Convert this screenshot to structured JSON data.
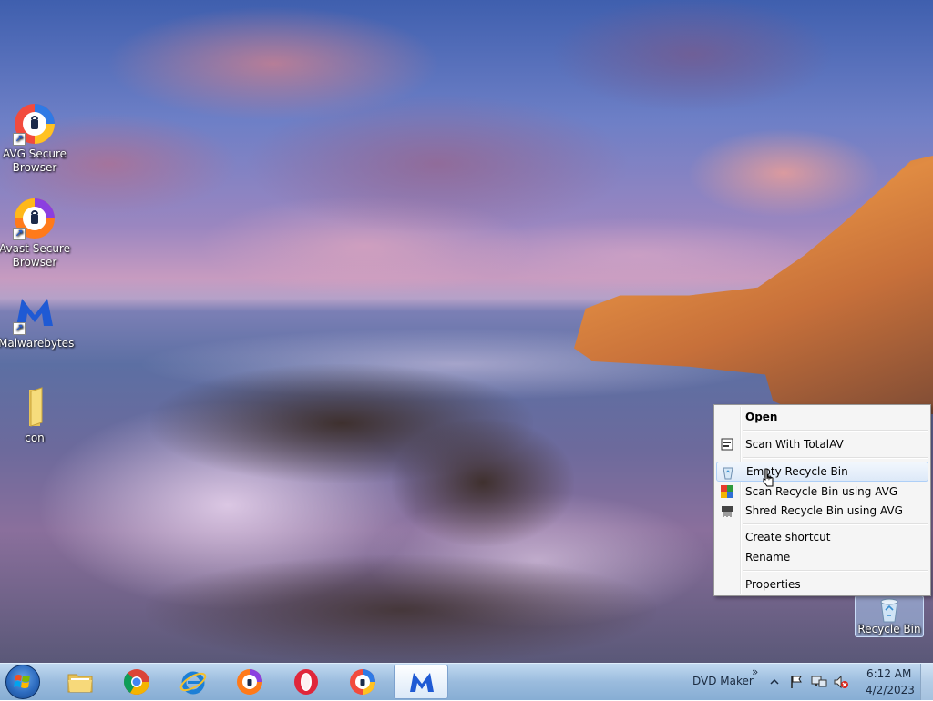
{
  "desktop": {
    "icons": [
      {
        "label": "AVG Secure Browser",
        "icon": "avg-browser-icon"
      },
      {
        "label": "Avast Secure Browser",
        "icon": "avast-browser-icon"
      },
      {
        "label": "Malwarebytes",
        "icon": "malwarebytes-icon"
      },
      {
        "label": "con",
        "icon": "folder-icon"
      }
    ],
    "recycle_bin": {
      "label": "Recycle Bin",
      "icon": "recycle-bin-icon"
    }
  },
  "context_menu": {
    "items": [
      {
        "label": "Open",
        "bold": true
      },
      {
        "label": "Scan With TotalAV",
        "icon": "totalav-icon"
      },
      {
        "label": "Empty Recycle Bin",
        "icon": "recycle-bin-small-icon",
        "highlighted": true
      },
      {
        "label": "Scan Recycle Bin using AVG",
        "icon": "avg-icon"
      },
      {
        "label": "Shred Recycle Bin using AVG",
        "icon": "shredder-icon"
      },
      {
        "label": "Create shortcut"
      },
      {
        "label": "Rename"
      },
      {
        "label": "Properties"
      }
    ]
  },
  "taskbar": {
    "start_icon": "windows-start-icon",
    "pinned": [
      {
        "name": "file-explorer",
        "icon": "folder-icon"
      },
      {
        "name": "chrome",
        "icon": "chrome-icon"
      },
      {
        "name": "internet-explorer",
        "icon": "ie-icon"
      },
      {
        "name": "avast-browser",
        "icon": "avast-browser-icon"
      },
      {
        "name": "opera",
        "icon": "opera-icon"
      },
      {
        "name": "avg-browser",
        "icon": "avg-browser-icon"
      },
      {
        "name": "malwarebytes",
        "icon": "malwarebytes-icon",
        "active": true
      }
    ],
    "toolbar_label": "DVD Maker",
    "toolbar_chevron": "»",
    "tray": {
      "time": "6:12 AM",
      "date": "4/2/2023"
    }
  }
}
